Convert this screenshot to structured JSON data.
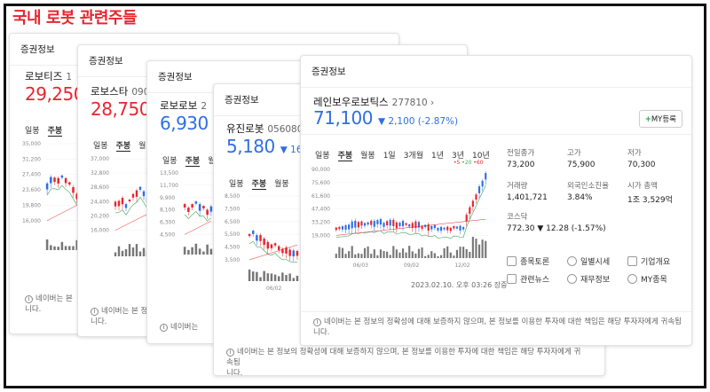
{
  "headline": "국내 로봇 관련주들",
  "cards": [
    {
      "header": "증권정보",
      "name": "로보티즈",
      "code": "1",
      "price": "29,250",
      "tabs": [
        "일봉",
        "주봉"
      ],
      "active_tab": 1,
      "ylabels": [
        "35,000",
        "31,200",
        "27,400",
        "23,600",
        "19,800",
        "16,000"
      ],
      "disclaimer": "네이버는 본\n니다."
    },
    {
      "header": "증권정보",
      "name": "로보스타",
      "code": "090",
      "price": "28,750",
      "tabs": [
        "일봉",
        "주봉",
        "월"
      ],
      "active_tab": 1,
      "ylabels": [
        "37,000",
        "32,800",
        "28,600",
        "24,400",
        "20,200",
        "16,000"
      ],
      "disclaimer": "네이버는 본 정\n니다."
    },
    {
      "header": "증권정보",
      "name": "로보로보",
      "code": "2",
      "price": "6,930",
      "change_arrow": "▼",
      "tabs": [
        "일봉",
        "주봉",
        "월"
      ],
      "active_tab": 1,
      "ylabels": [
        "13,500",
        "11,700",
        "9,900",
        "8,100",
        "6,300",
        "4,500"
      ],
      "disclaimer": "네이버는"
    },
    {
      "header": "증권정보",
      "name": "유진로봇",
      "code": "056080",
      "price": "5,180",
      "change": "▼ 16",
      "tabs": [
        "일봉",
        "주봉",
        "월봉"
      ],
      "active_tab": 1,
      "ylabels": [
        "8,500",
        "7,500",
        "6,500",
        "5,500",
        "4,500",
        "3,500"
      ],
      "xlabels": [
        "06/02"
      ],
      "disclaimer": "네이버는 본 정보의 정확성에 대해 보증하지 않으며, 본 정보를 이용한 투자에 대한 책임은 해당 투자자에게 귀속됩\n니다."
    }
  ],
  "main": {
    "header": "증권정보",
    "name": "레인보우로보틱스",
    "code": "277810 ›",
    "price": "71,100",
    "change": "▼ 2,100 (-2.87%)",
    "my_button_plus": "+",
    "my_button": "MY등록",
    "tabs": [
      "일봉",
      "주봉",
      "월봉",
      "1일",
      "3개월",
      "1년",
      "3년",
      "10년"
    ],
    "active_tab": 1,
    "legend": [
      "•5",
      "•20",
      "•60"
    ],
    "ylabels": [
      "90,000",
      "75,600",
      "61,600",
      "47,400",
      "33,200",
      "19,000"
    ],
    "xlabels": [
      "06/03",
      "09/02",
      "12/02"
    ],
    "date": "2023.02.10. 오후 03:26 장중",
    "stats": {
      "prev_close_label": "전일종가",
      "prev_close": "73,200",
      "high_label": "고가",
      "high": "75,900",
      "low_label": "저가",
      "low": "70,300",
      "volume_label": "거래량",
      "volume": "1,401,721",
      "foreign_label": "외국인소진율",
      "foreign": "3.84%",
      "mcap_label": "시가 총액",
      "mcap": "1조 3,529억"
    },
    "kosdaq_label": "코스닥",
    "kosdaq_value": "772.30",
    "kosdaq_change": "▼ 12.28 (-1.57%)",
    "links": [
      "종목토론",
      "일별시세",
      "기업개요",
      "관련뉴스",
      "재무정보",
      "MY종목"
    ],
    "disclaimer": "네이버는 본 정보의 정확성에 대해 보증하지 않으며, 본 정보를 이용한 투자에 대한 책임은 해당 투자자에게 귀속됩\n니다."
  },
  "colors": {
    "up": "#e8262e",
    "down": "#2f6fe4",
    "ma20": "#3aa657",
    "ma60": "#e8262e"
  }
}
